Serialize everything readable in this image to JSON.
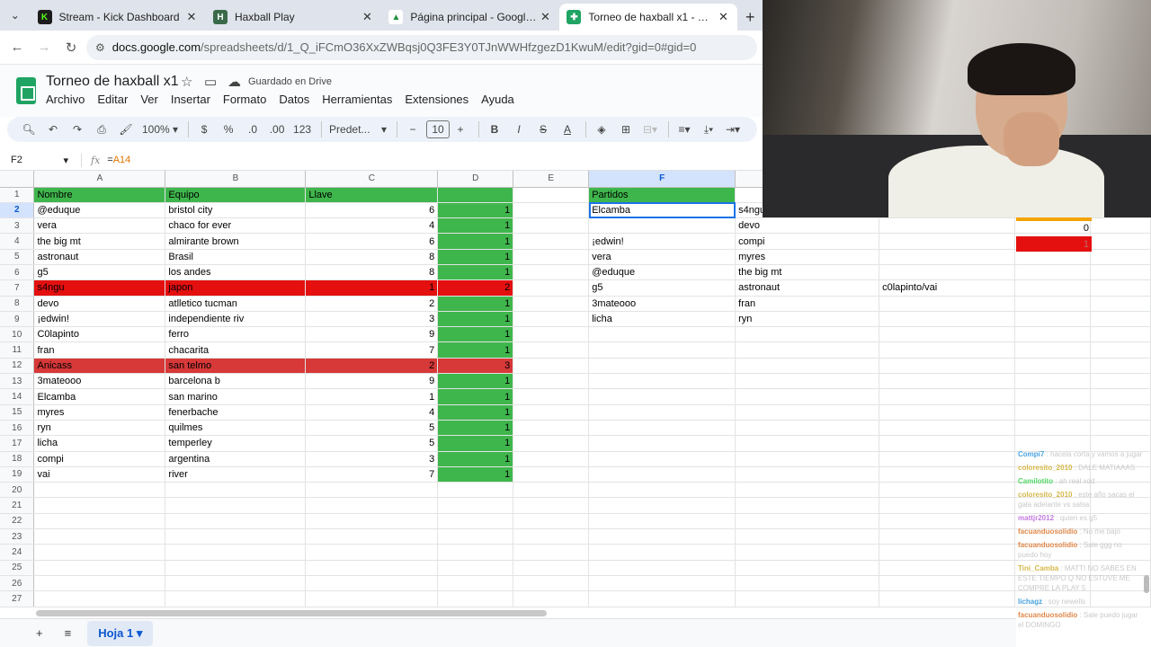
{
  "tabs": [
    {
      "title": "Stream - Kick Dashboard",
      "fav": "K",
      "color": "#1c1c1c"
    },
    {
      "title": "Haxball Play",
      "fav": "H",
      "color": "#3a6a4a"
    },
    {
      "title": "Página principal - Google Drive",
      "fav": "▲",
      "color": "#ffffff"
    },
    {
      "title": "Torneo de haxball x1 - Hojas de cálculo",
      "fav": "✚",
      "color": "#1fa463"
    }
  ],
  "url": {
    "host": "docs.google.com",
    "path": "/spreadsheets/d/1_Q_iFCmO36XxZWBqsj0Q3FE3Y0TJnWWHfzgezD1KwuM/edit?gid=0#gid=0"
  },
  "doc": {
    "title": "Torneo de haxball x1",
    "save_status": "Guardado en Drive"
  },
  "menu": [
    "Archivo",
    "Editar",
    "Ver",
    "Insertar",
    "Formato",
    "Datos",
    "Herramientas",
    "Extensiones",
    "Ayuda"
  ],
  "toolbar": {
    "zoom": "100%",
    "currency": "$",
    "percent": "%",
    "dec_minus": ".0",
    "dec_plus": ".00",
    "format_123": "123",
    "font": "Predet...",
    "font_size": "10",
    "bold": "B",
    "italic": "I",
    "strike": "S",
    "text_color": "A"
  },
  "formula_bar": {
    "cell": "F2",
    "formula_prefix": "=",
    "formula_ref": "A14"
  },
  "columns": [
    "A",
    "B",
    "C",
    "D",
    "E",
    "F",
    "G"
  ],
  "rows": [
    {
      "n": 1,
      "a": "Nombre",
      "b": "Equipo",
      "c": "Llave",
      "d": "",
      "e": "",
      "f": "Partidos",
      "g": ""
    },
    {
      "n": 2,
      "a": "@eduque",
      "b": "bristol city",
      "c": "6",
      "d": "1",
      "e": "",
      "f": "Elcamba",
      "g": "s4ngu"
    },
    {
      "n": 3,
      "a": "vera",
      "b": "chaco for ever",
      "c": "4",
      "d": "1",
      "e": "",
      "f": "",
      "g": "devo"
    },
    {
      "n": 4,
      "a": "the big mt",
      "b": "almirante brown",
      "c": "6",
      "d": "1",
      "e": "",
      "f": "¡edwin!",
      "g": "compi"
    },
    {
      "n": 5,
      "a": "astronaut",
      "b": "Brasil",
      "c": "8",
      "d": "1",
      "e": "",
      "f": "vera",
      "g": "myres"
    },
    {
      "n": 6,
      "a": "g5",
      "b": "los andes",
      "c": "8",
      "d": "1",
      "e": "",
      "f": "@eduque",
      "g": "the big mt"
    },
    {
      "n": 7,
      "a": "s4ngu",
      "b": "japon",
      "c": "1",
      "d": "2",
      "e": "",
      "f": "g5",
      "g": "astronaut"
    },
    {
      "n": 8,
      "a": "devo",
      "b": "atlletico tucman",
      "c": "2",
      "d": "1",
      "e": "",
      "f": "3mateooo",
      "g": "fran"
    },
    {
      "n": 9,
      "a": "¡edwin!",
      "b": "independiente riv",
      "c": "3",
      "d": "1",
      "e": "",
      "f": "licha",
      "g": "ryn"
    },
    {
      "n": 10,
      "a": "C0lapinto",
      "b": "ferro",
      "c": "9",
      "d": "1",
      "e": "",
      "f": "",
      "g": ""
    },
    {
      "n": 11,
      "a": "fran",
      "b": "chacarita",
      "c": "7",
      "d": "1",
      "e": "",
      "f": "",
      "g": ""
    },
    {
      "n": 12,
      "a": "Anicass",
      "b": "san telmo",
      "c": "2",
      "d": "3",
      "e": "",
      "f": "",
      "g": ""
    },
    {
      "n": 13,
      "a": "3mateooo",
      "b": "barcelona b",
      "c": "9",
      "d": "1",
      "e": "",
      "f": "",
      "g": ""
    },
    {
      "n": 14,
      "a": "Elcamba",
      "b": "san marino",
      "c": "1",
      "d": "1",
      "e": "",
      "f": "",
      "g": ""
    },
    {
      "n": 15,
      "a": "myres",
      "b": "fenerbache",
      "c": "4",
      "d": "1",
      "e": "",
      "f": "",
      "g": ""
    },
    {
      "n": 16,
      "a": "ryn",
      "b": "quilmes",
      "c": "5",
      "d": "1",
      "e": "",
      "f": "",
      "g": ""
    },
    {
      "n": 17,
      "a": "licha",
      "b": "temperley",
      "c": "5",
      "d": "1",
      "e": "",
      "f": "",
      "g": ""
    },
    {
      "n": 18,
      "a": "compi",
      "b": "argentina",
      "c": "3",
      "d": "1",
      "e": "",
      "f": "",
      "g": ""
    },
    {
      "n": 19,
      "a": "vai",
      "b": "river",
      "c": "7",
      "d": "1",
      "e": "",
      "f": "",
      "g": ""
    },
    {
      "n": 20
    },
    {
      "n": 21
    },
    {
      "n": 22
    },
    {
      "n": 23
    },
    {
      "n": 24
    },
    {
      "n": 25
    },
    {
      "n": 26
    },
    {
      "n": 27
    }
  ],
  "extra": {
    "h7": "c0lapinto/vai",
    "far_right_r3": "0",
    "far_right_r4": "1"
  },
  "sheet_tab": "Hoja 1",
  "chat": [
    {
      "user": "Compi7",
      "text": "hacela corta y vamos a jugar",
      "color": "#4aa3df"
    },
    {
      "user": "coloresito_2010",
      "text": "DALE MATIAAAS",
      "color": "#d6b84a"
    },
    {
      "user": "Camilotito",
      "text": "ah real xdd",
      "color": "#53d769"
    },
    {
      "user": "coloresito_2010",
      "text": "este año sacas el gala adelante vs salsa",
      "color": "#d6b84a"
    },
    {
      "user": "mattjr2012",
      "text": "quien es g5",
      "color": "#c27ae0"
    },
    {
      "user": "facuanduosolidio",
      "text": "No me bajo",
      "color": "#e0884a"
    },
    {
      "user": "facuanduosolidio",
      "text": "Sale ggg no puedo hoy",
      "color": "#e0884a"
    },
    {
      "user": "Tini_Camba",
      "text": "MATTI NO SABES EN ESTE TIEMPO Q NO ESTUVE ME COMPRE LA PLAY 5",
      "color": "#d6b84a"
    },
    {
      "user": "lichagz",
      "text": "soy newells",
      "color": "#4aa3df"
    },
    {
      "user": "facuanduosolidio",
      "text": "Sale puedo jugar el DOMINGO",
      "color": "#e0884a"
    }
  ]
}
